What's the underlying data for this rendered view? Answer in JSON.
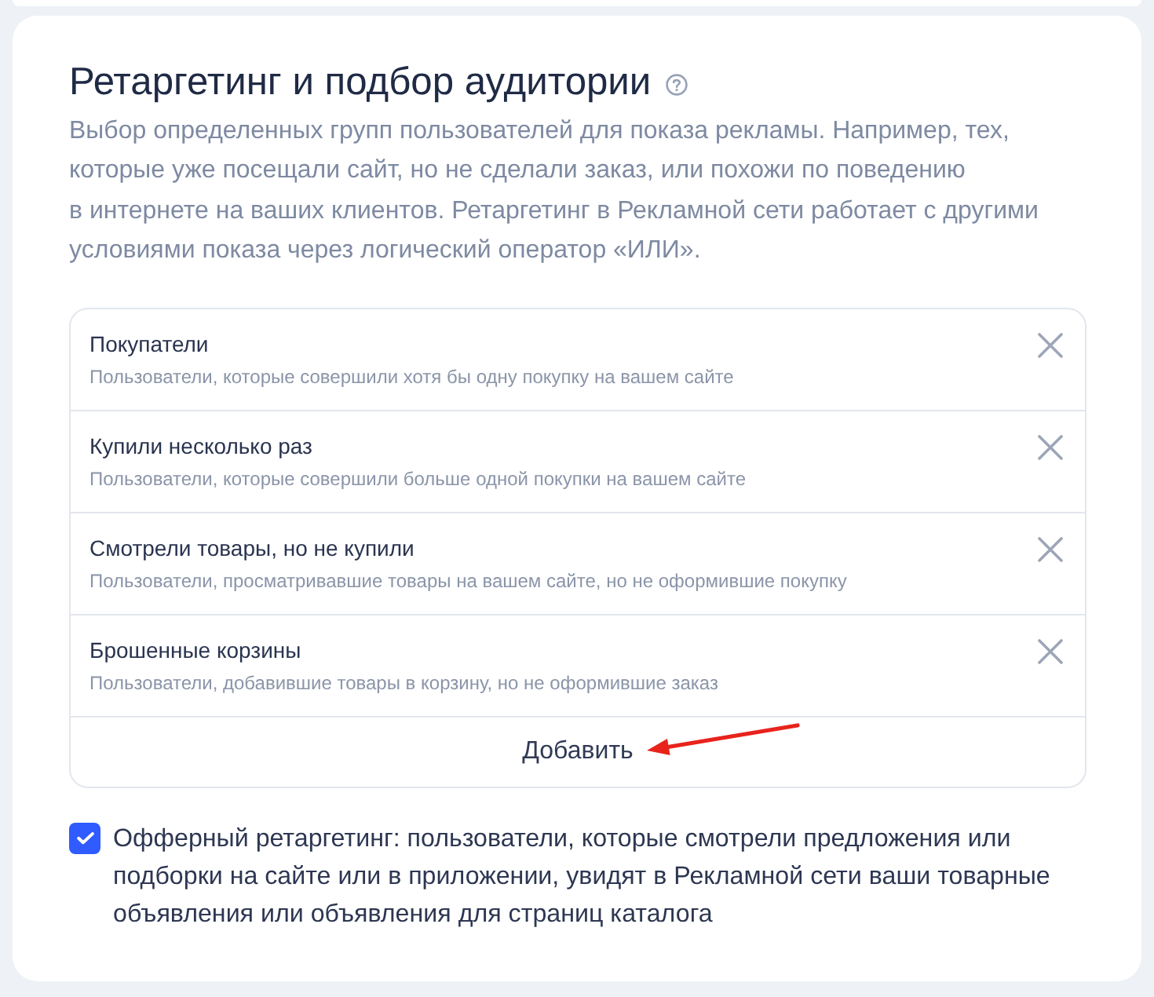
{
  "header": {
    "title": "Ретаргетинг и подбор аудитории",
    "description": "Выбор определенных групп пользователей для показа рекламы. Например, тех, которые уже посещали сайт, но не сделали заказ, или похожи по поведению в интернете на ваших клиентов. Ретаргетинг в Рекламной сети работает с другими условиями показа через логический оператор «ИЛИ»."
  },
  "audiences": [
    {
      "name": "Покупатели",
      "description": "Пользователи, которые совершили хотя бы одну покупку на вашем сайте"
    },
    {
      "name": "Купили несколько раз",
      "description": "Пользователи, которые совершили больше одной покупки на вашем сайте"
    },
    {
      "name": "Смотрели товары, но не купили",
      "description": "Пользователи, просматривавшие товары на вашем сайте, но не оформившие покупку"
    },
    {
      "name": "Брошенные корзины",
      "description": "Пользователи, добавившие товары в корзину, но не оформившие заказ"
    }
  ],
  "add_button": {
    "label": "Добавить"
  },
  "offer_retargeting": {
    "checked": true,
    "label": "Офферный ретаргетинг: пользователи, которые смотрели предложения или подборки на сайте или в приложении, увидят в Рекламной сети ваши товарные объявления или объявления для страниц каталога"
  }
}
